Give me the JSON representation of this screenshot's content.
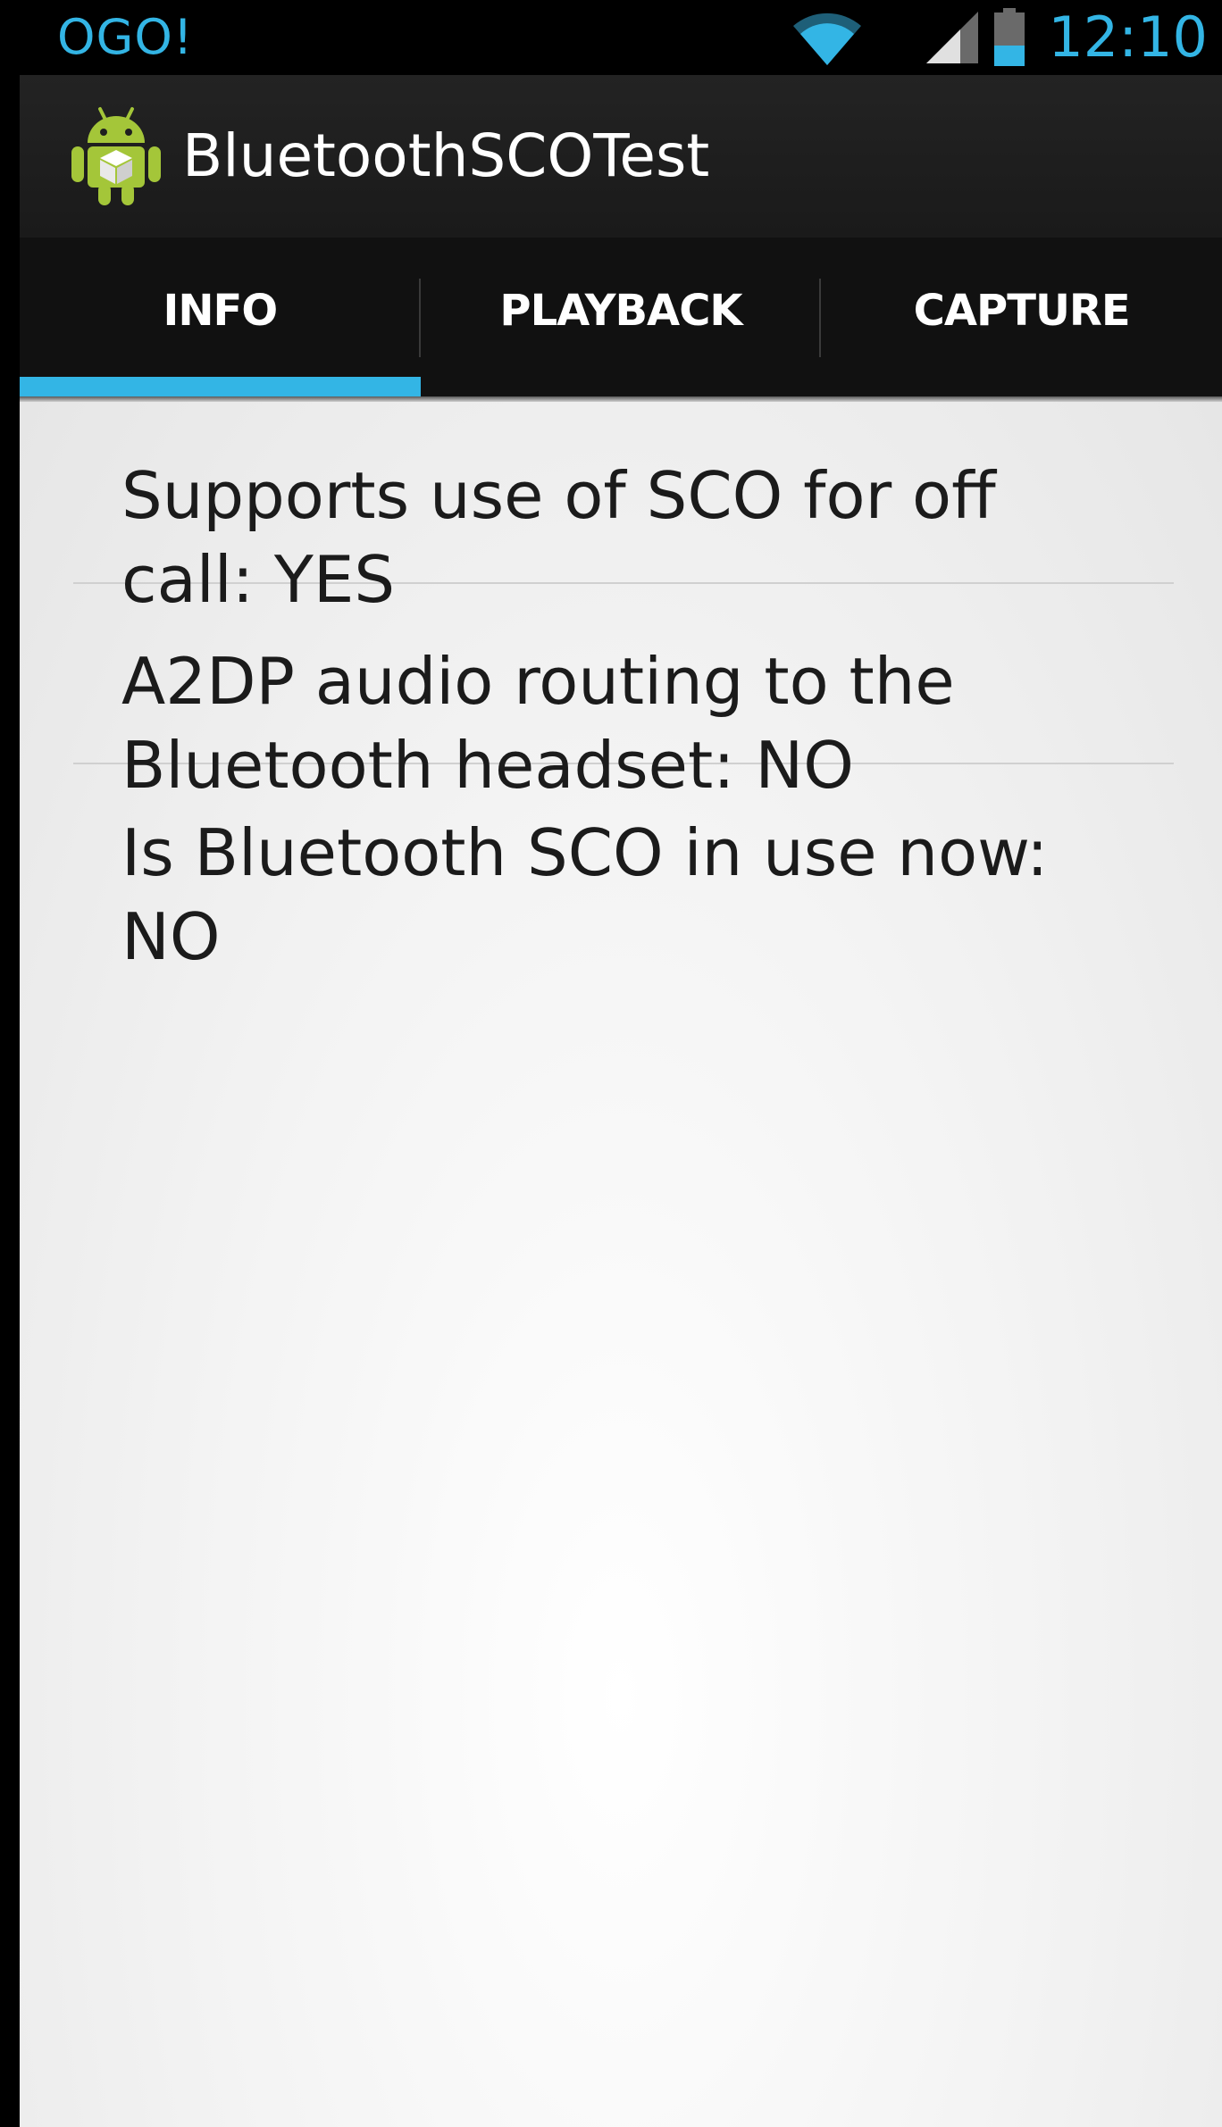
{
  "status_bar": {
    "carrier": "OGO!",
    "time": "12:10",
    "icons": [
      "wifi-icon",
      "signal-icon",
      "battery-icon"
    ],
    "accent_color": "#33b5e5"
  },
  "action_bar": {
    "title": "BluetoothSCOTest",
    "icon": "android-app-icon"
  },
  "tabs": [
    {
      "label": "INFO",
      "selected": true
    },
    {
      "label": "PLAYBACK",
      "selected": false
    },
    {
      "label": "CAPTURE",
      "selected": false
    }
  ],
  "info": {
    "items": [
      {
        "text": "Supports use of SCO for off call: YES"
      },
      {
        "text": "A2DP audio routing to the Bluetooth headset: NO"
      },
      {
        "text": "Is Bluetooth SCO in use now: NO"
      }
    ]
  },
  "colors": {
    "tab_indicator": "#33b5e5",
    "action_bar_bg": "#1f1f1f",
    "content_bg": "#f2f2f2"
  }
}
